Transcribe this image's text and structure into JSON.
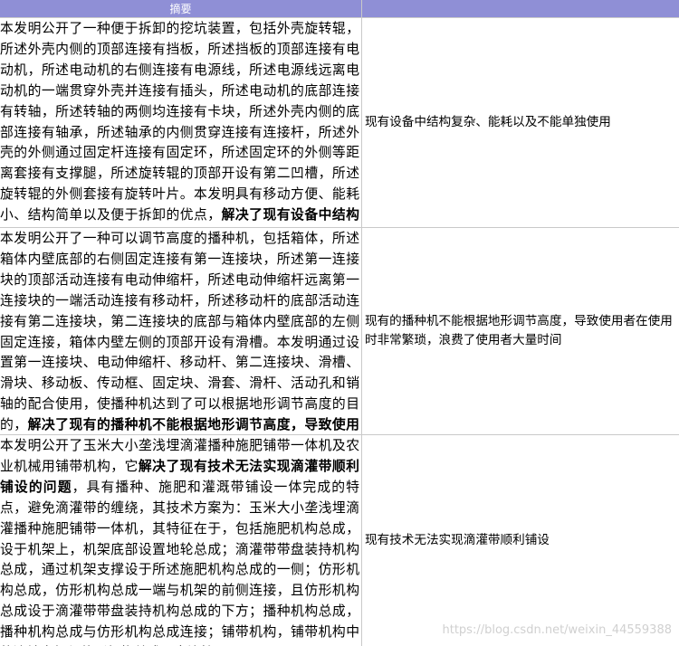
{
  "table": {
    "header": {
      "abstract": "摘要",
      "problem": ""
    },
    "rows": [
      {
        "abstract_plain": "本发明公开了一种便于拆卸的挖坑装置，包括外壳旋转辊，所述外壳内侧的顶部连接有挡板，所述挡板的顶部连接有电动机，所述电动机的右侧连接有电源线，所述电源线远离电动机的一端贯穿外壳并连接有插头，所述电动机的底部连接有转轴，所述转轴的两侧均连接有卡块，所述外壳内侧的底部连接有轴承，所述轴承的内侧贯穿连接有连接杆，所述外壳的外侧通过固定杆连接有固定环，所述固定环的外侧等距离套接有支撑腿，所述旋转辊的顶部开设有第二凹槽，所述旋转辊的外侧套接有旋转叶片。本发明具有移动方便、能耗小、结构简单以及便于拆卸的优点，",
        "abstract_bold": "解决了现有设备中结构复杂、能耗以及不能单独使用的问题。",
        "abstract_tail": "",
        "problem": "现有设备中结构复杂、能耗以及不能单独使用"
      },
      {
        "abstract_plain": "本发明公开了一种可以调节高度的播种机，包括箱体，所述箱体内壁底部的右侧固定连接有第一连接块，所述第一连接块的顶部活动连接有电动伸缩杆，所述电动伸缩杆远离第一连接块的一端活动连接有移动杆，所述移动杆的底部活动连接有第二连接块，第二连接块的底部与箱体内壁底部的左侧固定连接，箱体内壁左侧的顶部开设有滑槽。本发明通过设置第一连接块、电动伸缩杆、移动杆、第二连接块、滑槽、滑块、移动板、传动框、固定块、滑套、滑杆、活动孔和销轴的配合使用，使播种机达到了可以根据地形调节高度的目的，",
        "abstract_bold": "解决了现有的播种机不能根据地形调节高度，导致使用者在使用时非常繁琐，浪费了使用者大量时间的问题。",
        "abstract_tail": "",
        "problem": "现有的播种机不能根据地形调节高度，导致使用者在使用时非常繁琐，浪费了使用者大量时间"
      },
      {
        "abstract_plain": "本发明公开了玉米大小垄浅埋滴灌播种施肥铺带一体机及农业机械用铺带机构，它",
        "abstract_bold": "解决了现有技术无法实现滴灌带顺利铺设的问题",
        "abstract_tail": "，具有播种、施肥和灌溉带铺设一体完成的特点，避免滴灌带的缠绕，其技术方案为：玉米大小垄浅埋滴灌播种施肥铺带一体机，其特征在于，包括施肥机构总成，设于机架上，机架底部设置地轮总成；滴灌带带盘装持机构总成，通过机架支撑设于所述施肥机构总成的一侧；仿形机构总成，仿形机构总成一端与机架的前侧连接，且仿形机构总成设于滴灌带带盘装持机构总成的下方；播种机构总成，播种机构总成与仿形机构总成连接；铺带机构，铺带机构中的滚轮支架与仿形机构总成固定连接。",
        "problem": "现有技术无法实现滴灌带顺利铺设"
      }
    ]
  },
  "watermark": "https://blog.csdn.net/weixin_44559388"
}
